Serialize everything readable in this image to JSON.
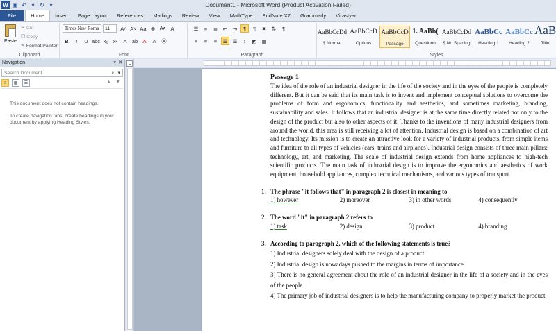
{
  "window": {
    "title": "Document1 - Microsoft Word (Product Activation Failed)"
  },
  "tabs": [
    "File",
    "Home",
    "Insert",
    "Page Layout",
    "References",
    "Mailings",
    "Review",
    "View",
    "MathType",
    "EndNote X7",
    "Grammarly",
    "Virastyar"
  ],
  "clipboard": {
    "paste": "Paste",
    "cut": "Cut",
    "copy": "Copy",
    "format_painter": "Format Painter",
    "label": "Clipboard"
  },
  "font": {
    "name": "Times New Roma",
    "size": "11",
    "label": "Font"
  },
  "paragraph": {
    "label": "Paragraph"
  },
  "styles": {
    "label": "Styles",
    "items": [
      {
        "sample": "AaBbCcDd",
        "name": "¶ Normal"
      },
      {
        "sample": "AaBbCcD",
        "name": "Options"
      },
      {
        "sample": "AaBbCcD",
        "name": "Passage"
      },
      {
        "sample": "1. AaBb(",
        "name": "Questionn"
      },
      {
        "sample": "AaBbCcDd",
        "name": "¶ No Spacing"
      },
      {
        "sample": "AaBbCc",
        "name": "Heading 1"
      },
      {
        "sample": "AaBbCc",
        "name": "Heading 2"
      },
      {
        "sample": "AaB",
        "name": "Title"
      }
    ]
  },
  "nav": {
    "title": "Navigation",
    "search_placeholder": "Search Document",
    "msg1": "This document does not contain headings.",
    "msg2": "To create navigation tabs, create headings in your document by applying Heading Styles."
  },
  "document": {
    "passage_title": "Passage 1",
    "passage_text": "The idea of the role of an industrial designer in the life of the society and in the eyes of the people is completely different. But it can be said that its main task is to invent and implement conceptual solutions to overcome the problems of form and ergonomics, functionality and aesthetics, and sometimes marketing, branding, sustainability and sales. It follows that an industrial designer is at the same time directly related not only to the design of the product but also to other aspects of it. Thanks to the inventions of many industrial designers from around the world, this area is still receiving a lot of attention. Industrial design is based on a combination of art and technology. Its mission is to create an attractive look for a variety of industrial products, from simple items and furniture to all types of vehicles (cars, trains and airplanes). Industrial design consists of three main pillars: technology, art, and marketing. The scale of industrial design extends from home appliances to high-tech scientific products. The main task of industrial design is to improve the ergonomics and aesthetics of work equipment, household appliances, complex technical mechanisms, and various types of transport.",
    "q1": {
      "num": "1.",
      "text": "The phrase \"it follows that\" in paragraph  2 is closest in meaning to",
      "opts": [
        "1) however",
        "2) moreover",
        "3) in other words",
        "4) consequently"
      ]
    },
    "q2": {
      "num": "2.",
      "text": "The word \"it\" in paragraph  2 refers to",
      "opts": [
        "1) task",
        "2) design",
        "3) product",
        "4) branding"
      ]
    },
    "q3": {
      "num": "3.",
      "text": "According  to paragraph  2, which of the following  statements is true?",
      "opts": [
        "1) Industrial designers solely deal with the design of a product.",
        "2) Industrial design is nowadays pushed to the margins in terms of importance.",
        "3) There is no general agreement about the role of an industrial designer in the life of a society and in the eyes of the people.",
        "4) The primary job of industrial designers is to help the manufacturing company to properly market the product."
      ]
    }
  }
}
